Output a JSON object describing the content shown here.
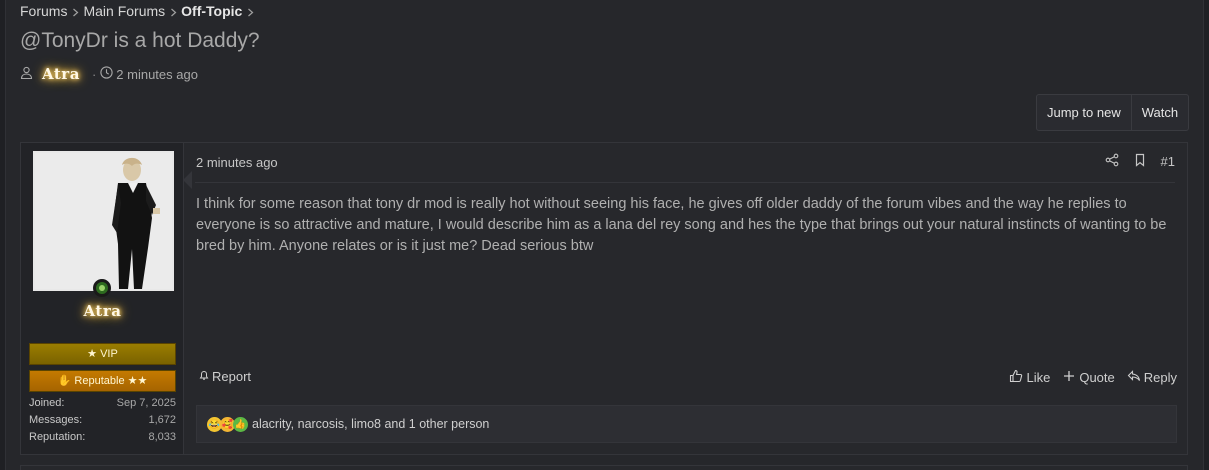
{
  "breadcrumb": {
    "items": [
      "Forums",
      "Main Forums",
      "Off-Topic"
    ]
  },
  "thread": {
    "title": "@TonyDr is a hot Daddy?",
    "author": "Atra",
    "time": "2 minutes ago"
  },
  "buttons": {
    "jump_to_new": "Jump to new",
    "watch": "Watch"
  },
  "post": {
    "user": {
      "name": "Atra",
      "banner_vip": "VIP",
      "banner_reputable": "Reputable ★★",
      "stats": [
        {
          "label": "Joined:",
          "value": "Sep 7, 2025"
        },
        {
          "label": "Messages:",
          "value": "1,672"
        },
        {
          "label": "Reputation:",
          "value": "8,033"
        }
      ]
    },
    "date": "2 minutes ago",
    "number": "#1",
    "body": "I think for some reason that tony dr mod is really hot without seeing his face, he gives off older daddy of the forum vibes and the way he replies to everyone is so attractive and mature, I would describe him as a lana del rey song and hes the type that brings out your natural instincts of wanting to be bred by him. Anyone relates or is it just me? Dead serious btw",
    "report_label": "Report",
    "like_label": "Like",
    "quote_label": "Quote",
    "reply_label": "Reply",
    "reactions_text": "alacrity, narcosis, limo8 and 1 other person"
  }
}
